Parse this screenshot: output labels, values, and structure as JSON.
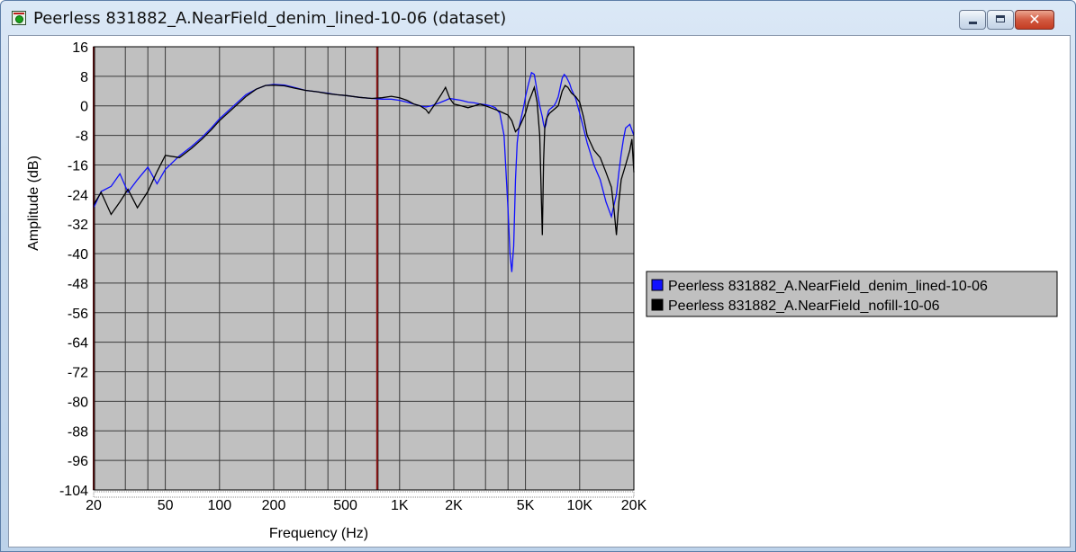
{
  "window": {
    "title": "Peerless 831882_A.NearField_denim_lined-10-06 (dataset)",
    "close_glyph": "✕"
  },
  "chart_data": {
    "type": "line",
    "title": "",
    "xlabel": "Frequency (Hz)",
    "ylabel": "Amplitude (dB)",
    "xscale": "log",
    "xlim": [
      20,
      20000
    ],
    "ylim": [
      -104,
      16
    ],
    "grid": true,
    "background": "#c0c0c0",
    "x_ticks": [
      {
        "value": 20,
        "label": "20"
      },
      {
        "value": 50,
        "label": "50"
      },
      {
        "value": 100,
        "label": "100"
      },
      {
        "value": 200,
        "label": "200"
      },
      {
        "value": 500,
        "label": "500"
      },
      {
        "value": 1000,
        "label": "1K"
      },
      {
        "value": 2000,
        "label": "2K"
      },
      {
        "value": 5000,
        "label": "5K"
      },
      {
        "value": 10000,
        "label": "10K"
      },
      {
        "value": 20000,
        "label": "20K"
      }
    ],
    "y_ticks": [
      16,
      8,
      0,
      -8,
      -16,
      -24,
      -32,
      -40,
      -48,
      -56,
      -64,
      -72,
      -80,
      -88,
      -96,
      -104
    ],
    "minor_x_gridlines": [
      30,
      40,
      300,
      400,
      3000,
      4000
    ],
    "markers": [
      {
        "x": 20,
        "color": "#8b1a1a"
      },
      {
        "x": 750,
        "color": "#8b1a1a"
      }
    ],
    "legend": {
      "placement": "right"
    },
    "series": [
      {
        "name": "Peerless 831882_A.NearField_denim_lined-10-06",
        "color": "#1010ff",
        "x": [
          20,
          22,
          25,
          28,
          31,
          35,
          40,
          45,
          50,
          60,
          70,
          80,
          90,
          100,
          120,
          140,
          160,
          180,
          200,
          230,
          260,
          300,
          350,
          400,
          450,
          500,
          600,
          700,
          800,
          900,
          1000,
          1100,
          1200,
          1300,
          1400,
          1500,
          1600,
          1700,
          1800,
          1900,
          2000,
          2200,
          2400,
          2600,
          2800,
          3000,
          3200,
          3400,
          3600,
          3800,
          4000,
          4100,
          4200,
          4300,
          4400,
          4500,
          4600,
          4700,
          4800,
          4900,
          5000,
          5200,
          5400,
          5600,
          5800,
          6000,
          6200,
          6300,
          6400,
          6500,
          6600,
          6700,
          6800,
          7000,
          7200,
          7400,
          7600,
          7800,
          8000,
          8200,
          8400,
          8600,
          8800,
          9000,
          9500,
          10000,
          10500,
          11000,
          11500,
          12000,
          13000,
          14000,
          15000,
          16000,
          16500,
          17000,
          17500,
          18000,
          19000,
          20000
        ],
        "y": [
          -24,
          -22,
          -23,
          -22,
          -21,
          -20,
          -19,
          -17.5,
          -16,
          -13.5,
          -11,
          -8.5,
          -6,
          -3.5,
          0,
          3,
          4.5,
          5.5,
          5.8,
          5.6,
          5,
          4.2,
          3.8,
          3.4,
          3,
          2.8,
          2.3,
          2,
          1.8,
          1.8,
          1.5,
          1,
          0.5,
          0,
          -0.3,
          0,
          0.5,
          1,
          1.5,
          2,
          1.8,
          1.5,
          1,
          0.8,
          0.5,
          0.3,
          0,
          -0.5,
          -2,
          -8,
          -28,
          -40,
          -45,
          -38,
          -20,
          -10,
          -6,
          -4,
          -2,
          0,
          2.5,
          6,
          9,
          8.5,
          4,
          0,
          -3,
          -5,
          -6,
          -5,
          -3,
          -1.5,
          -1,
          -0.5,
          0,
          1,
          2.5,
          5,
          7.5,
          8.5,
          8,
          7,
          6,
          4.5,
          2,
          -2,
          -6,
          -10,
          -13,
          -16,
          -20,
          -26,
          -30,
          -24,
          -18,
          -13,
          -9,
          -6,
          -5,
          -8
        ]
      },
      {
        "name": "Peerless 831882_A.NearField_nofill-10-06",
        "color": "#000000",
        "x": [
          20,
          22,
          25,
          28,
          31,
          35,
          40,
          45,
          50,
          60,
          70,
          80,
          90,
          100,
          120,
          140,
          160,
          180,
          200,
          230,
          260,
          300,
          350,
          400,
          450,
          500,
          600,
          700,
          800,
          900,
          1000,
          1100,
          1200,
          1300,
          1400,
          1450,
          1500,
          1600,
          1700,
          1800,
          1900,
          2000,
          2200,
          2400,
          2600,
          2800,
          3000,
          3200,
          3400,
          3600,
          3800,
          4000,
          4200,
          4400,
          4600,
          4800,
          5000,
          5200,
          5400,
          5600,
          5800,
          6000,
          6100,
          6200,
          6300,
          6400,
          6500,
          6600,
          6800,
          7000,
          7200,
          7400,
          7600,
          7800,
          8000,
          8300,
          8600,
          9000,
          9500,
          10000,
          10500,
          11000,
          12000,
          13000,
          14000,
          15000,
          15500,
          16000,
          16500,
          17000,
          18000,
          19000,
          19500,
          20000
        ],
        "y": [
          -28,
          -27,
          -27,
          -26,
          -25,
          -24,
          -22,
          -19,
          -17,
          -14,
          -11.5,
          -9,
          -6.5,
          -4,
          -0.5,
          2.5,
          4.5,
          5.5,
          5.6,
          5.4,
          4.8,
          4.2,
          3.8,
          3.3,
          3,
          2.8,
          2.3,
          2,
          2.2,
          2.6,
          2.2,
          1.5,
          0.5,
          0,
          -1,
          -2,
          -1,
          1,
          3,
          5,
          2,
          0.5,
          0,
          -0.5,
          0,
          0.5,
          0,
          -0.5,
          -1,
          -1.5,
          -2,
          -2.5,
          -4,
          -7,
          -6,
          -4,
          -2,
          1,
          3,
          5,
          1,
          -8,
          -22,
          -35,
          -15,
          -6,
          -4,
          -3,
          -2,
          -1.5,
          -1,
          -0.5,
          0,
          2,
          4,
          5.5,
          5,
          3.5,
          2.5,
          1,
          -3,
          -8,
          -12,
          -14,
          -18,
          -22,
          -28,
          -35,
          -26,
          -20,
          -16,
          -12,
          -9,
          -18
        ]
      }
    ]
  }
}
